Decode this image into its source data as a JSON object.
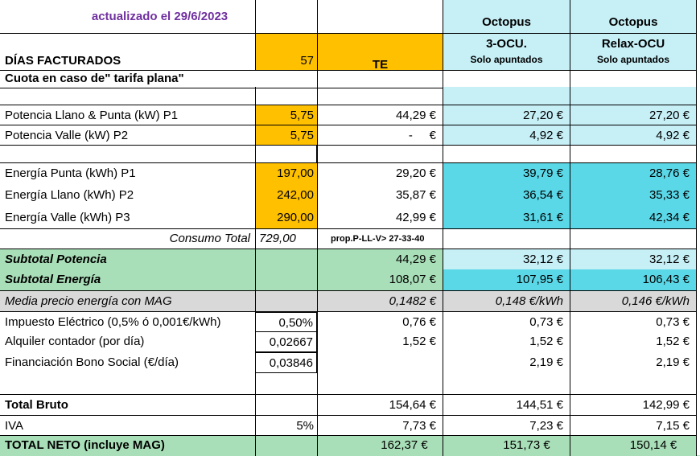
{
  "header": {
    "updated": "actualizado el 29/6/2023",
    "provider_a": "Octopus",
    "provider_b": "Octopus",
    "dias_label": "DÍAS FACTURADOS",
    "dias_value": "57",
    "te_label": "TE",
    "plan_a": "3-OCU.",
    "plan_a_sub": "Solo apuntados",
    "plan_b": "Relax-OCU",
    "plan_b_sub": "Solo apuntados",
    "cuota_note": "Cuota en caso de\" tarifa plana\""
  },
  "rows": {
    "pot_p1": {
      "label": "Potencia Llano & Punta (kW) P1",
      "qty": "5,75",
      "te": "44,29 €",
      "a": "27,20 €",
      "b": "27,20 €"
    },
    "pot_p2": {
      "label": "Potencia Valle (kW) P2",
      "qty": "5,75",
      "te": "-     €",
      "a": "4,92 €",
      "b": "4,92 €"
    },
    "en_p1": {
      "label": "Energía Punta (kWh) P1",
      "qty": "197,00",
      "te": "29,20 €",
      "a": "39,79 €",
      "b": "28,76 €"
    },
    "en_p2": {
      "label": "Energía Llano (kWh) P2",
      "qty": "242,00",
      "te": "35,87 €",
      "a": "36,54 €",
      "b": "35,33 €"
    },
    "en_p3": {
      "label": "Energía Valle (kWh) P3",
      "qty": "290,00",
      "te": "42,99 €",
      "a": "31,61 €",
      "b": "42,34 €"
    },
    "consumo": {
      "label": "Consumo Total",
      "qty": "729,00",
      "te": "prop.P-LL-V> 27-33-40"
    },
    "sub_pot": {
      "label": "Subtotal Potencia",
      "te": "44,29 €",
      "a": "32,12 €",
      "b": "32,12 €"
    },
    "sub_en": {
      "label": "Subtotal Energía",
      "te": "108,07 €",
      "a": "107,95 €",
      "b": "106,43 €"
    },
    "media": {
      "label": "Media precio energía con MAG",
      "te": "0,1482 €",
      "a": "0,148 €/kWh",
      "b": "0,146 €/kWh"
    },
    "impuesto": {
      "label": "Impuesto Eléctrico (0,5% ó 0,001€/kWh)",
      "qty": "0,50%",
      "te": "0,76 €",
      "a": "0,73 €",
      "b": "0,73 €"
    },
    "alquiler": {
      "label": "Alquiler contador (por día)",
      "qty": "0,02667",
      "te": "1,52 €",
      "a": "1,52 €",
      "b": "1,52 €"
    },
    "bono": {
      "label": "Financiación Bono Social (€/día)",
      "qty": "0,03846",
      "te": "",
      "a": "2,19 €",
      "b": "2,19 €"
    },
    "bruto": {
      "label": "Total Bruto",
      "te": "154,64 €",
      "a": "144,51 €",
      "b": "142,99 €"
    },
    "iva": {
      "label": "IVA",
      "qty": "5%",
      "te": "7,73 €",
      "a": "7,23 €",
      "b": "7,15 €"
    },
    "neto": {
      "label": "TOTAL NETO (incluye MAG)",
      "te": "162,37 €",
      "a": "151,73 €",
      "b": "150,14 €"
    }
  },
  "colors": {
    "orange": "#ffc000",
    "light_cyan": "#c6eff6",
    "dark_cyan": "#5bd8e8",
    "green": "#a9dfb8",
    "grey": "#d9d9d9",
    "purple": "#7030a0"
  }
}
